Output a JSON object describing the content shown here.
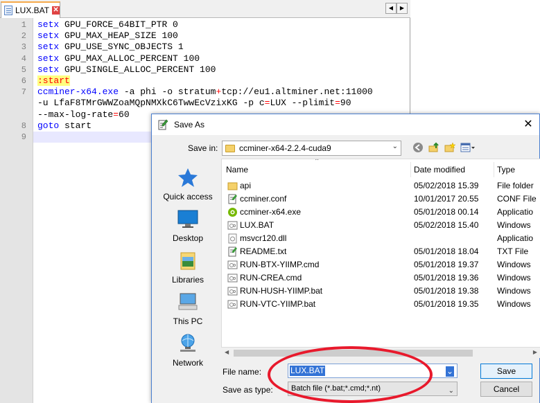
{
  "editor": {
    "tab_label": "LUX.BAT",
    "lines": [
      {
        "n": "1",
        "parts": [
          {
            "t": "setx",
            "c": "kw"
          },
          {
            "t": " GPU_FORCE_64BIT_PTR 0",
            "c": "pl"
          }
        ]
      },
      {
        "n": "2",
        "parts": [
          {
            "t": "setx",
            "c": "kw"
          },
          {
            "t": " GPU_MAX_HEAP_SIZE 100",
            "c": "pl"
          }
        ]
      },
      {
        "n": "3",
        "parts": [
          {
            "t": "setx",
            "c": "kw"
          },
          {
            "t": " GPU_USE_SYNC_OBJECTS 1",
            "c": "pl"
          }
        ]
      },
      {
        "n": "4",
        "parts": [
          {
            "t": "setx",
            "c": "kw"
          },
          {
            "t": " GPU_MAX_ALLOC_PERCENT 100",
            "c": "pl"
          }
        ]
      },
      {
        "n": "5",
        "parts": [
          {
            "t": "setx",
            "c": "kw"
          },
          {
            "t": " GPU_SINGLE_ALLOC_PERCENT 100",
            "c": "pl"
          }
        ]
      },
      {
        "n": "6",
        "parts": [
          {
            "t": ":start",
            "c": "lbl"
          }
        ]
      },
      {
        "n": "7",
        "parts": [
          {
            "t": "ccminer-x64.exe",
            "c": "kw"
          },
          {
            "t": " -a phi -o stratum",
            "c": "pl"
          },
          {
            "t": "+",
            "c": "op"
          },
          {
            "t": "tcp://eu1.altminer.net:11000",
            "c": "pl"
          }
        ]
      },
      {
        "n": "",
        "parts": [
          {
            "t": "-u LfaF8TMrGWWZoaMQpNMXkC6TwwEcVzixKG -p c",
            "c": "pl"
          },
          {
            "t": "=",
            "c": "op"
          },
          {
            "t": "LUX --plimit",
            "c": "pl"
          },
          {
            "t": "=",
            "c": "op"
          },
          {
            "t": "90",
            "c": "pl"
          }
        ]
      },
      {
        "n": "",
        "parts": [
          {
            "t": "--max-log-rate",
            "c": "pl"
          },
          {
            "t": "=",
            "c": "op"
          },
          {
            "t": "60",
            "c": "pl"
          }
        ]
      },
      {
        "n": "8",
        "parts": [
          {
            "t": "goto",
            "c": "kw"
          },
          {
            "t": " start",
            "c": "pl"
          }
        ]
      },
      {
        "n": "9",
        "parts": []
      }
    ]
  },
  "dialog": {
    "title": "Save As",
    "close_glyph": "✕",
    "save_in_label": "Save in:",
    "save_in_value": "ccminer-x64-2.2.4-cuda9",
    "places": [
      "Quick access",
      "Desktop",
      "Libraries",
      "This PC",
      "Network"
    ],
    "columns": {
      "name": "Name",
      "date": "Date modified",
      "type": "Type"
    },
    "files": [
      {
        "name": "api",
        "date": "05/02/2018 15.39",
        "type": "File folder",
        "icon": "folder"
      },
      {
        "name": "ccminer.conf",
        "date": "10/01/2017 20.55",
        "type": "CONF File",
        "icon": "conf"
      },
      {
        "name": "ccminer-x64.exe",
        "date": "05/01/2018 00.14",
        "type": "Applicatio",
        "icon": "nvidia"
      },
      {
        "name": "LUX.BAT",
        "date": "05/02/2018 15.40",
        "type": "Windows",
        "icon": "bat"
      },
      {
        "name": "msvcr120.dll",
        "date": "",
        "type": "Applicatio",
        "icon": "dll"
      },
      {
        "name": "README.txt",
        "date": "05/01/2018 18.04",
        "type": "TXT File",
        "icon": "conf"
      },
      {
        "name": "RUN-BTX-YIIMP.cmd",
        "date": "05/01/2018 19.37",
        "type": "Windows",
        "icon": "bat"
      },
      {
        "name": "RUN-CREA.cmd",
        "date": "05/01/2018 19.36",
        "type": "Windows",
        "icon": "bat"
      },
      {
        "name": "RUN-HUSH-YIIMP.bat",
        "date": "05/01/2018 19.38",
        "type": "Windows",
        "icon": "bat"
      },
      {
        "name": "RUN-VTC-YIIMP.bat",
        "date": "05/01/2018 19.35",
        "type": "Windows",
        "icon": "bat"
      }
    ],
    "file_name_label": "File name:",
    "file_name_value": "LUX.BAT",
    "save_as_type_label": "Save as type:",
    "save_as_type_value": "Batch file (*.bat;*.cmd;*.nt)",
    "save_button": "Save",
    "cancel_button": "Cancel"
  },
  "colors": {
    "highlight_ellipse": "#e8192c",
    "keyword": "#0000ff",
    "operator": "#ff0000"
  }
}
